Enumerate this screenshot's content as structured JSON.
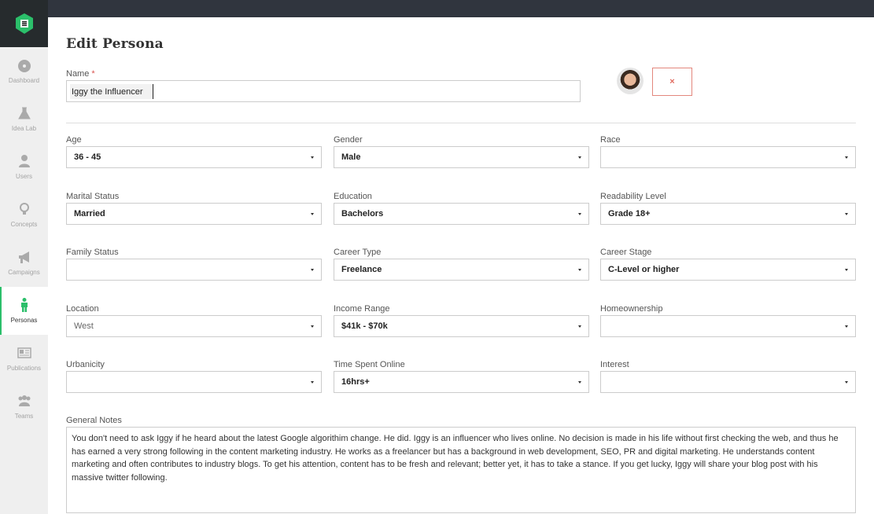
{
  "sidebar": {
    "items": [
      {
        "label": "Dashboard",
        "icon": "dashboard-icon"
      },
      {
        "label": "Idea Lab",
        "icon": "flask-icon"
      },
      {
        "label": "Users",
        "icon": "user-icon"
      },
      {
        "label": "Concepts",
        "icon": "lightbulb-icon"
      },
      {
        "label": "Campaigns",
        "icon": "megaphone-icon"
      },
      {
        "label": "Personas",
        "icon": "person-icon",
        "active": true
      },
      {
        "label": "Publications",
        "icon": "newspaper-icon"
      },
      {
        "label": "Teams",
        "icon": "users-icon"
      }
    ]
  },
  "colors": {
    "accent": "#2bbf6a",
    "topbar": "#30353e",
    "remove": "#e06a5e"
  },
  "page": {
    "title": "Edit Persona",
    "name_label": "Name",
    "required_mark": "*",
    "name_value": "Iggy the Influencer",
    "remove_icon": "×"
  },
  "fields": [
    {
      "label": "Age",
      "value": "36 - 45"
    },
    {
      "label": "Gender",
      "value": "Male"
    },
    {
      "label": "Race",
      "value": ""
    },
    {
      "label": "Marital Status",
      "value": "Married"
    },
    {
      "label": "Education",
      "value": "Bachelors"
    },
    {
      "label": "Readability Level",
      "value": "Grade 18+"
    },
    {
      "label": "Family Status",
      "value": ""
    },
    {
      "label": "Career Type",
      "value": "Freelance"
    },
    {
      "label": "Career Stage",
      "value": "C-Level or higher"
    },
    {
      "label": "Location",
      "value": "West",
      "placeholder": true
    },
    {
      "label": "Income Range",
      "value": "$41k - $70k"
    },
    {
      "label": "Homeownership",
      "value": ""
    },
    {
      "label": "Urbanicity",
      "value": ""
    },
    {
      "label": "Time Spent Online",
      "value": "16hrs+"
    },
    {
      "label": "Interest",
      "value": ""
    }
  ],
  "notes": {
    "label": "General Notes",
    "value": "You don't need to ask Iggy if he heard about the latest Google algorithim change. He did.  Iggy is an influencer who lives online. No decision is made in his life without first checking the web, and thus he has earned a very strong following in the content marketing industry. He works as a freelancer but has a background in web development, SEO, PR and digital marketing. He understands content marketing and often contributes to industry blogs. To get his attention, content has to be fresh and relevant; better yet, it has to take a stance. If you get lucky, Iggy will share your blog post with his massive twitter following."
  }
}
